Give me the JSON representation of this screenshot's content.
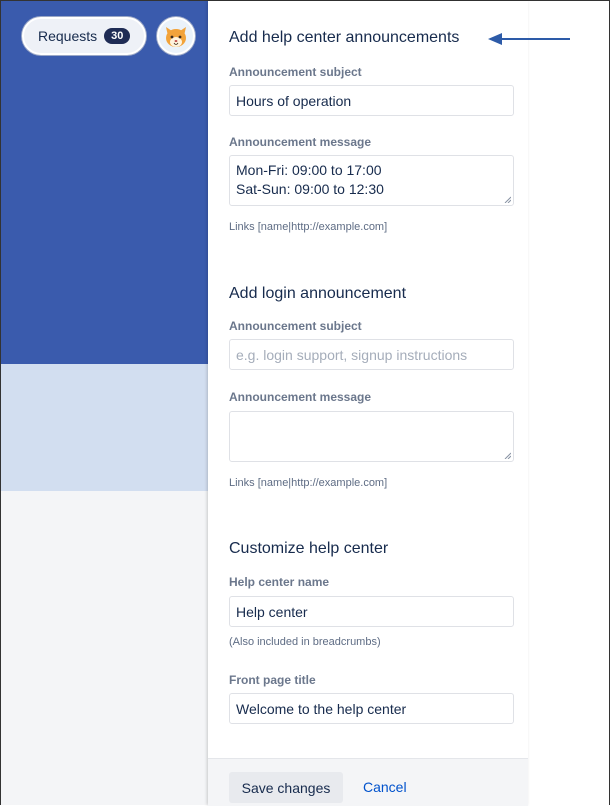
{
  "header": {
    "requests_label": "Requests",
    "requests_count": "30",
    "avatar_icon": "cat-avatar-icon"
  },
  "help_center_announcements": {
    "title": "Add help center announcements",
    "subject_label": "Announcement subject",
    "subject_value": "Hours of operation",
    "message_label": "Announcement message",
    "message_lines": [
      "Mon-Fri: 09:00 to 17:00",
      "Sat-Sun: 09:00 to 12:30"
    ],
    "links_hint": "Links [name|http://example.com]"
  },
  "login_announcement": {
    "title": "Add login announcement",
    "subject_label": "Announcement subject",
    "subject_placeholder": "e.g. login support, signup instructions",
    "message_label": "Announcement message",
    "message_value": "",
    "links_hint": "Links [name|http://example.com]"
  },
  "customize": {
    "title": "Customize help center",
    "name_label": "Help center name",
    "name_value": "Help center",
    "name_hint": "(Also included in breadcrumbs)",
    "front_title_label": "Front page title",
    "front_title_value": "Welcome to the help center"
  },
  "footer": {
    "save_label": "Save changes",
    "cancel_label": "Cancel"
  },
  "colors": {
    "sidebar_blue": "#3A5BAD",
    "link_blue": "#0052CC",
    "annotation_arrow": "#2D5BA8"
  }
}
